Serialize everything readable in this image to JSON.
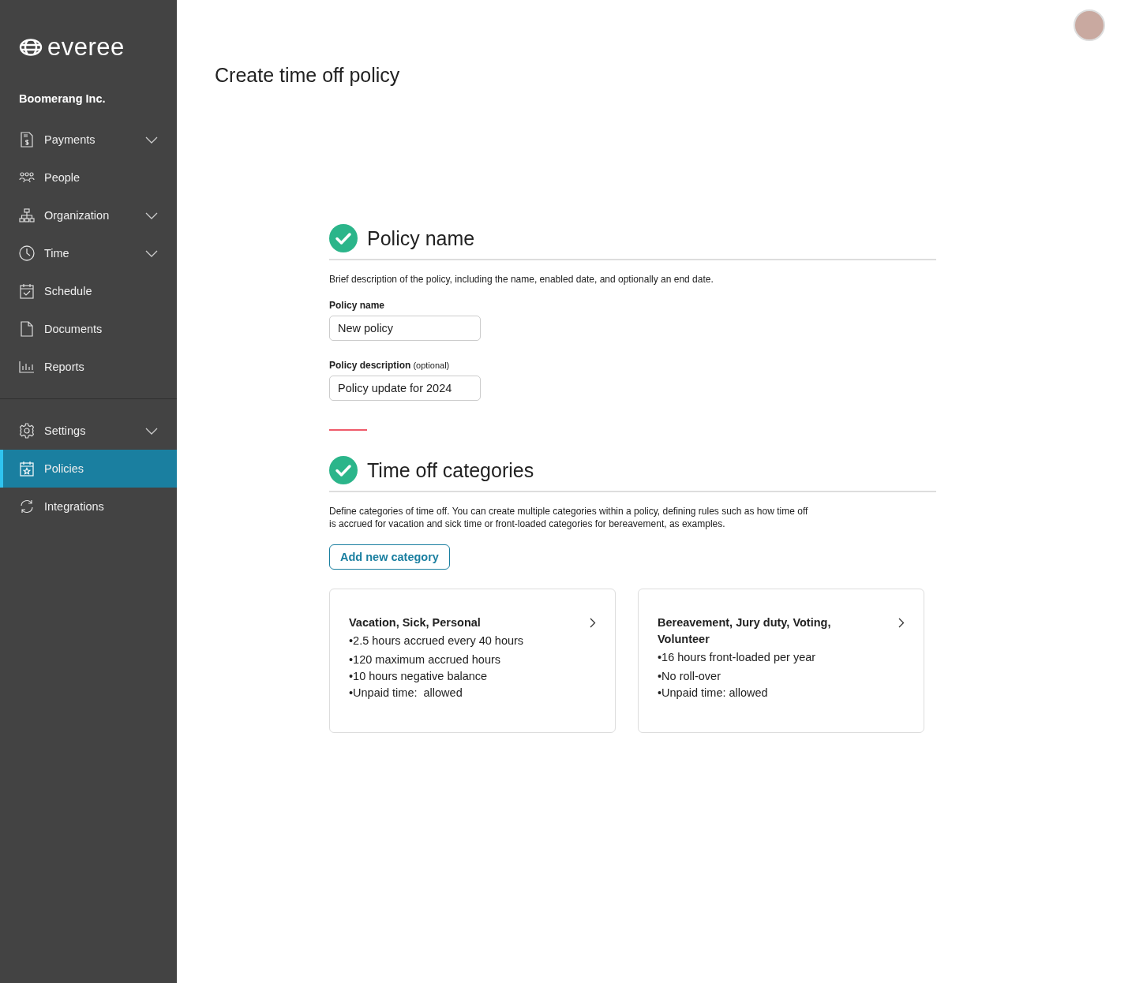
{
  "sidebar": {
    "logo": "everee",
    "company": "Boomerang Inc.",
    "groups": [
      [
        {
          "label": "Payments",
          "has_submenu": true,
          "selected": false
        },
        {
          "label": "People",
          "has_submenu": false,
          "selected": false
        },
        {
          "label": "Organization",
          "has_submenu": true,
          "selected": false
        },
        {
          "label": "Time",
          "has_submenu": true,
          "selected": false
        },
        {
          "label": "Schedule",
          "has_submenu": false,
          "selected": false
        },
        {
          "label": "Documents",
          "has_submenu": false,
          "selected": false
        },
        {
          "label": "Reports",
          "has_submenu": false,
          "selected": false
        }
      ],
      [
        {
          "label": "Settings",
          "has_submenu": true,
          "selected": false
        },
        {
          "label": "Policies",
          "has_submenu": false,
          "selected": true
        },
        {
          "label": "Integrations",
          "has_submenu": false,
          "selected": false
        }
      ]
    ]
  },
  "page": {
    "title": "Create time off policy"
  },
  "sections": [
    {
      "kind": "form",
      "title": "Policy name",
      "completed": true,
      "description": "Brief description of the policy, including the name, enabled date, and optionally an end date.",
      "fields": [
        {
          "label": "Policy name",
          "value": "New policy"
        },
        {
          "label": "Policy description",
          "hint": "(optional)",
          "value": "Policy update for 2024"
        }
      ]
    },
    {
      "kind": "categories",
      "title": "Time off categories",
      "completed": true,
      "description": "Define categories of time off. You can create multiple categories within a policy, defining rules such as how time off\nis accrued for vacation and sick time or front-loaded categories for bereavement, as examples.",
      "button": "Add new category",
      "cards": [
        {
          "title": "Vacation, Sick, Personal",
          "lines": [
            "•2.5 hours accrued every 40 hours",
            "•120 maximum accrued hours",
            "•10 hours negative balance",
            "•Unpaid time:  allowed"
          ]
        },
        {
          "title": "Bereavement, Jury duty, Voting, Volunteer",
          "lines": [
            "•16 hours front-loaded per year",
            "•No roll-over",
            "•Unpaid time: allowed"
          ]
        }
      ]
    }
  ]
}
